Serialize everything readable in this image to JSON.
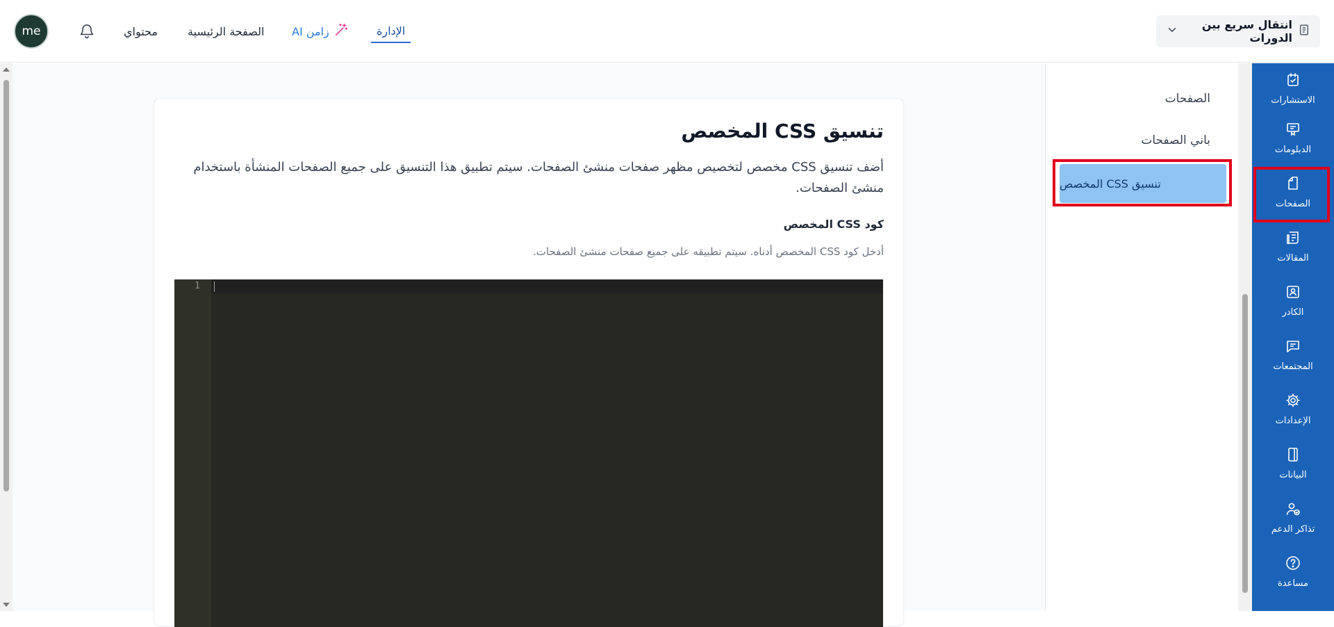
{
  "header": {
    "avatar_initials": "me",
    "nav": {
      "my_content": "محتواي",
      "home": "الصفحة الرئيسية",
      "ai": "زامن AI",
      "admin": "الإدارة"
    },
    "course_switch_label": "انتقال سريع بين الدورات"
  },
  "content": {
    "title": "تنسيق CSS المخصص",
    "description": "أضف تنسيق CSS مخصص لتخصيص مظهر صفحات منشئ الصفحات. سيتم تطبيق هذا التنسيق على جميع الصفحات المنشأة باستخدام منشئ الصفحات.",
    "field_label": "كود CSS المخصص",
    "field_help": "أدخل كود CSS المخصص أدناه. سيتم تطبيقه على جميع صفحات منشئ الصفحات.",
    "editor": {
      "line_numbers": [
        "1"
      ],
      "value": ""
    }
  },
  "submenu": {
    "items": [
      {
        "label": "الصفحات"
      },
      {
        "label": "باني الصفحات"
      },
      {
        "label": "تنسيق CSS المخصص",
        "active": true
      }
    ]
  },
  "sidebar": {
    "items": [
      {
        "label": "الاستشارات",
        "icon": "calendar-check-icon"
      },
      {
        "label": "الدبلومات",
        "icon": "certificate-icon"
      },
      {
        "label": "الصفحات",
        "icon": "page-icon",
        "active": true
      },
      {
        "label": "المقالات",
        "icon": "article-icon"
      },
      {
        "label": "الكادر",
        "icon": "staff-icon"
      },
      {
        "label": "المجتمعات",
        "icon": "chat-icon"
      },
      {
        "label": "الإعدادات",
        "icon": "gear-icon"
      },
      {
        "label": "البيانات",
        "icon": "book-icon"
      },
      {
        "label": "تذاكر الدعم",
        "icon": "user-check-icon"
      },
      {
        "label": "مساعدة",
        "icon": "help-icon"
      }
    ]
  },
  "colors": {
    "sidebar_bg": "#1b63b8",
    "active_submenu_bg": "#8ec3f2",
    "highlight_border": "#e0001b",
    "editor_bg": "#272822"
  }
}
